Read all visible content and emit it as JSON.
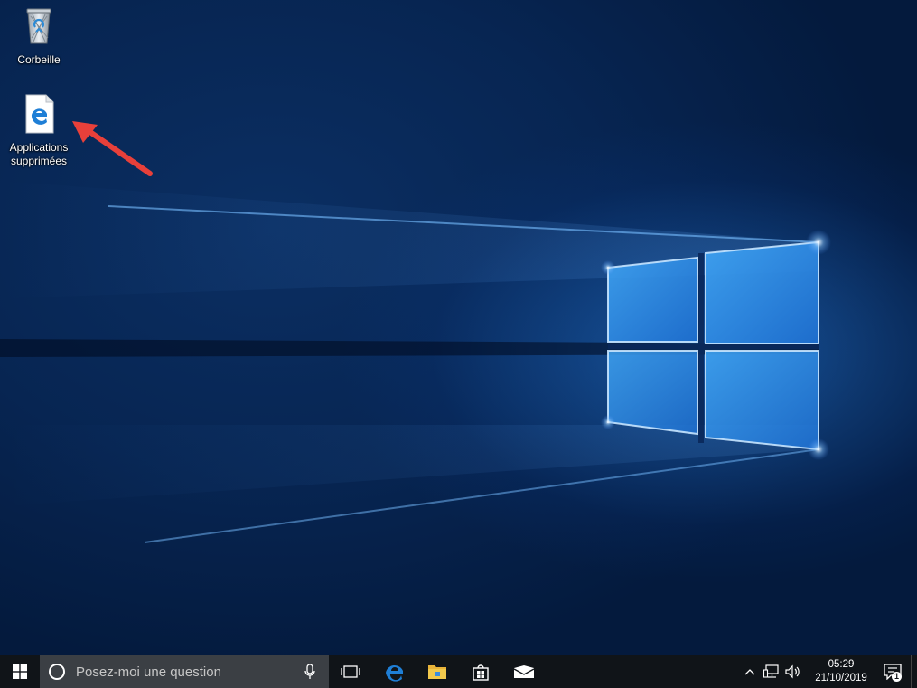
{
  "desktop": {
    "icons": [
      {
        "name": "recycle-bin",
        "label": "Corbeille",
        "icon": "recycle-bin-icon"
      },
      {
        "name": "deleted-apps",
        "label": "Applications supprimées",
        "icon": "edge-document-icon"
      }
    ],
    "annotation": {
      "icon": "red-arrow-icon",
      "color": "#e8403a"
    }
  },
  "taskbar": {
    "start_icon": "windows-logo-icon",
    "search": {
      "placeholder": "Posez-moi une question",
      "icon": "cortana-icon",
      "mic_icon": "microphone-icon"
    },
    "task_view_icon": "task-view-icon",
    "pinned": [
      {
        "name": "edge",
        "icon": "edge-icon",
        "color": "#1f7fd6"
      },
      {
        "name": "file-explorer",
        "icon": "folder-icon",
        "color": "#f2c94c"
      },
      {
        "name": "store",
        "icon": "store-icon",
        "color": "#ffffff"
      },
      {
        "name": "mail",
        "icon": "mail-icon",
        "color": "#ffffff"
      }
    ],
    "tray": {
      "icons": [
        "chevron-up-icon",
        "network-icon",
        "volume-icon"
      ],
      "time": "05:29",
      "date": "21/10/2019",
      "notification_count": "1"
    }
  },
  "colors": {
    "accent": "#1f7fd6",
    "taskbar": "#101418",
    "search_bg": "#3b3f44"
  }
}
